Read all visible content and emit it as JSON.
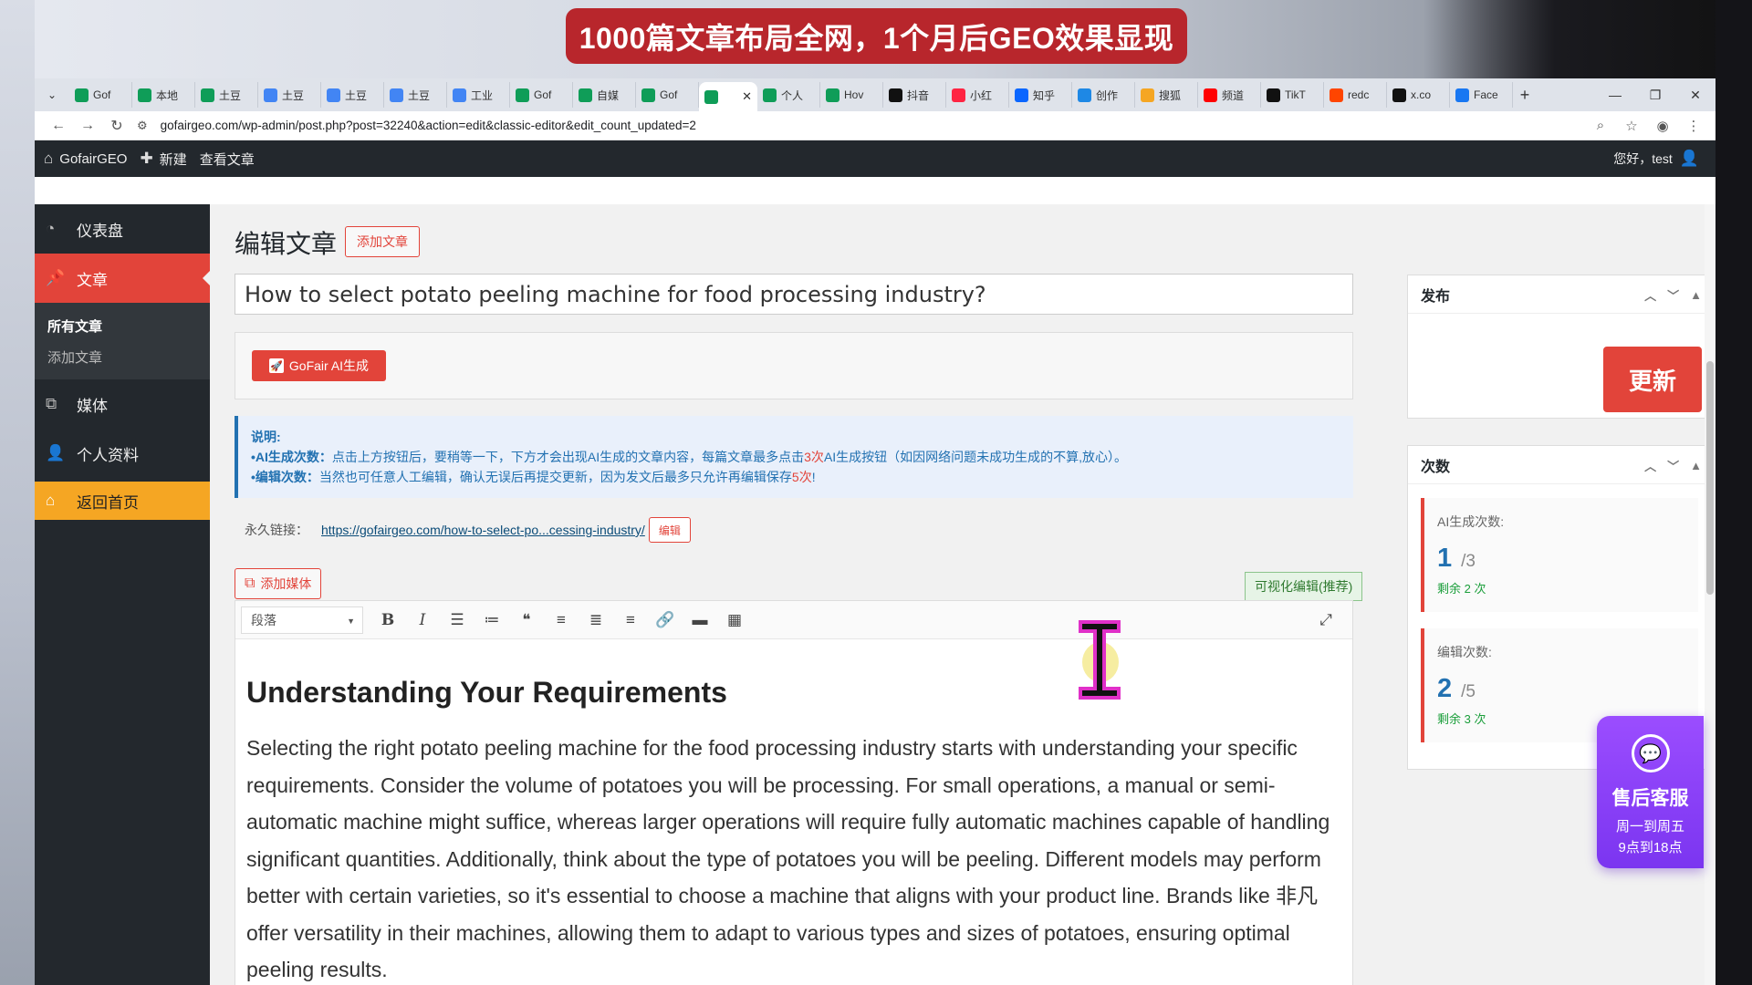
{
  "banner": {
    "text": "1000篇文章布局全网，1个月后GEO效果显现"
  },
  "browser": {
    "tabs": [
      {
        "label": "Gof",
        "icon": "green-sheet-icon",
        "color": "#0f9d58"
      },
      {
        "label": "本地",
        "icon": "green-sheet-icon",
        "color": "#0f9d58"
      },
      {
        "label": "土豆",
        "icon": "green-sheet-icon",
        "color": "#0f9d58"
      },
      {
        "label": "土豆",
        "icon": "google-icon",
        "color": "#4285f4"
      },
      {
        "label": "土豆",
        "icon": "google-icon",
        "color": "#4285f4"
      },
      {
        "label": "土豆",
        "icon": "google-icon",
        "color": "#4285f4"
      },
      {
        "label": "工业",
        "icon": "google-icon",
        "color": "#4285f4"
      },
      {
        "label": "Gof",
        "icon": "green-sheet-icon",
        "color": "#0f9d58"
      },
      {
        "label": "自媒",
        "icon": "green-sheet-icon",
        "color": "#0f9d58"
      },
      {
        "label": "Gof",
        "icon": "green-sheet-icon",
        "color": "#0f9d58"
      },
      {
        "label": "",
        "icon": "green-sheet-icon",
        "color": "#0f9d58",
        "active": true
      },
      {
        "label": "个人",
        "icon": "green-sheet-icon",
        "color": "#0f9d58"
      },
      {
        "label": "Hov",
        "icon": "green-sheet-icon",
        "color": "#0f9d58"
      },
      {
        "label": "抖音",
        "icon": "tiktok-icon",
        "color": "#111111"
      },
      {
        "label": "小红",
        "icon": "xiaohongshu-icon",
        "color": "#ff2442"
      },
      {
        "label": "知乎",
        "icon": "zhihu-icon",
        "color": "#0a66ff"
      },
      {
        "label": "创作",
        "icon": "calendar-icon",
        "color": "#1e88e5"
      },
      {
        "label": "搜狐",
        "icon": "sohu-icon",
        "color": "#f5a623"
      },
      {
        "label": "频道",
        "icon": "youtube-icon",
        "color": "#ff0000"
      },
      {
        "label": "TikT",
        "icon": "tiktok-icon",
        "color": "#111111"
      },
      {
        "label": "redc",
        "icon": "reddit-icon",
        "color": "#ff4500"
      },
      {
        "label": "x.co",
        "icon": "x-icon",
        "color": "#111111"
      },
      {
        "label": "Face",
        "icon": "facebook-icon",
        "color": "#1877f2"
      }
    ],
    "url": "gofairgeo.com/wp-admin/post.php?post=32240&action=edit&classic-editor&edit_count_updated=2"
  },
  "wpbar": {
    "site": "GofairGEO",
    "new": "新建",
    "view": "查看文章",
    "greeting": "您好，test"
  },
  "sidebar": {
    "dashboard": "仪表盘",
    "posts": "文章",
    "all_posts": "所有文章",
    "add_post": "添加文章",
    "media": "媒体",
    "profile": "个人资料",
    "home": "返回首页"
  },
  "editor": {
    "page_title": "编辑文章",
    "add_new": "添加文章",
    "post_title": "How to select potato peeling machine for food processing industry?",
    "ai_button": "GoFair AI生成",
    "notice": {
      "heading": "说明:",
      "l1_label": "•AI生成次数：",
      "l1_a": "点击上方按钮后，要稍等一下，下方才会出现AI生成的文章内容，每篇文章最多点击",
      "l1_hl": "3次",
      "l1_b": "AI生成按钮（如因网络问题未成功生成的不算,放心）。",
      "l2_label": "•编辑次数：",
      "l2_a": "当然也可任意人工编辑，确认无误后再提交更新，因为发文后最多只允许再编辑保存",
      "l2_hl": "5次",
      "l2_b": "!"
    },
    "permalink_label": "永久链接：",
    "permalink_url": "https://gofairgeo.com/how-to-select-po...cessing-industry/",
    "permalink_edit": "编辑",
    "add_media": "添加媒体",
    "visual_tab": "可视化编辑(推荐)",
    "format": "段落",
    "heading": "Understanding Your Requirements",
    "body": "Selecting the right potato peeling machine for the food processing industry starts with understanding your specific requirements. Consider the volume of potatoes you will be processing. For small operations, a manual or semi-automatic machine might suffice, whereas larger operations will require fully automatic machines capable of handling significant quantities. Additionally, think about the type of potatoes you will be peeling. Different models may perform better with certain varieties, so it's essential to choose a machine that aligns with your product line. Brands like 非凡 offer versatility in their machines, allowing them to adapt to various types and sizes of potatoes, ensuring optimal peeling results."
  },
  "publish": {
    "title": "发布",
    "update": "更新"
  },
  "counts": {
    "title": "次数",
    "ai_label": "AI生成次数:",
    "ai_used": "1",
    "ai_total": "/3",
    "ai_remaining": "剩余 2 次",
    "edit_label": "编辑次数:",
    "edit_used": "2",
    "edit_total": "/5",
    "edit_remaining": "剩余 3 次"
  },
  "service": {
    "title": "售后客服",
    "line1": "周一到周五",
    "line2": "9点到18点"
  },
  "colors": {
    "accent": "#e2443a",
    "link": "#2271b1",
    "admin_bar": "#23282d",
    "home": "#f5a623",
    "service": "#8a40f8"
  }
}
